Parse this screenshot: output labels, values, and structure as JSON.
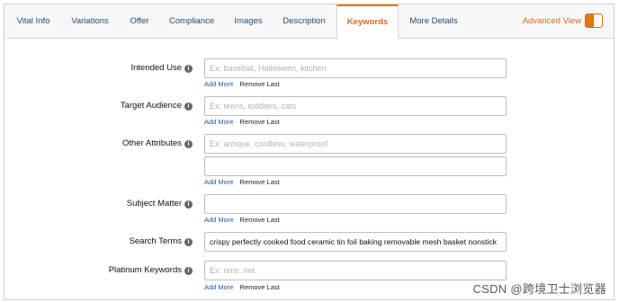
{
  "tabs": [
    {
      "label": "Vital Info"
    },
    {
      "label": "Variations"
    },
    {
      "label": "Offer"
    },
    {
      "label": "Compliance"
    },
    {
      "label": "Images"
    },
    {
      "label": "Description"
    },
    {
      "label": "Keywords",
      "active": true
    },
    {
      "label": "More Details"
    }
  ],
  "advanced_view": {
    "label": "Advanced View",
    "enabled": true
  },
  "info_glyph": "i",
  "links": {
    "add_more": "Add More",
    "remove_last": "Remove Last"
  },
  "fields": {
    "intended_use": {
      "label": "Intended Use",
      "placeholder": "Ex: baseball, Halloween, kitchen",
      "value": ""
    },
    "target_audience": {
      "label": "Target Audience",
      "placeholder": "Ex: teens, toddlers, cats",
      "value": ""
    },
    "other_attributes": {
      "label": "Other Attributes",
      "placeholder": "Ex: antique, cordless, waterproof",
      "value": "",
      "value2": ""
    },
    "subject_matter": {
      "label": "Subject Matter",
      "placeholder": "",
      "value": ""
    },
    "search_terms": {
      "label": "Search Terms",
      "placeholder": "",
      "value": "crispy perfectly cooked food ceramic tin foil baking removable mesh basket nonstick"
    },
    "platinum_keywords": {
      "label": "Platinum Keywords",
      "placeholder": "Ex: rims, net",
      "value": ""
    }
  },
  "watermark": "CSDN @跨境卫士浏览器",
  "colors": {
    "accent": "#e47911",
    "link": "#1b5aa6",
    "tab_text": "#1b4f79"
  }
}
